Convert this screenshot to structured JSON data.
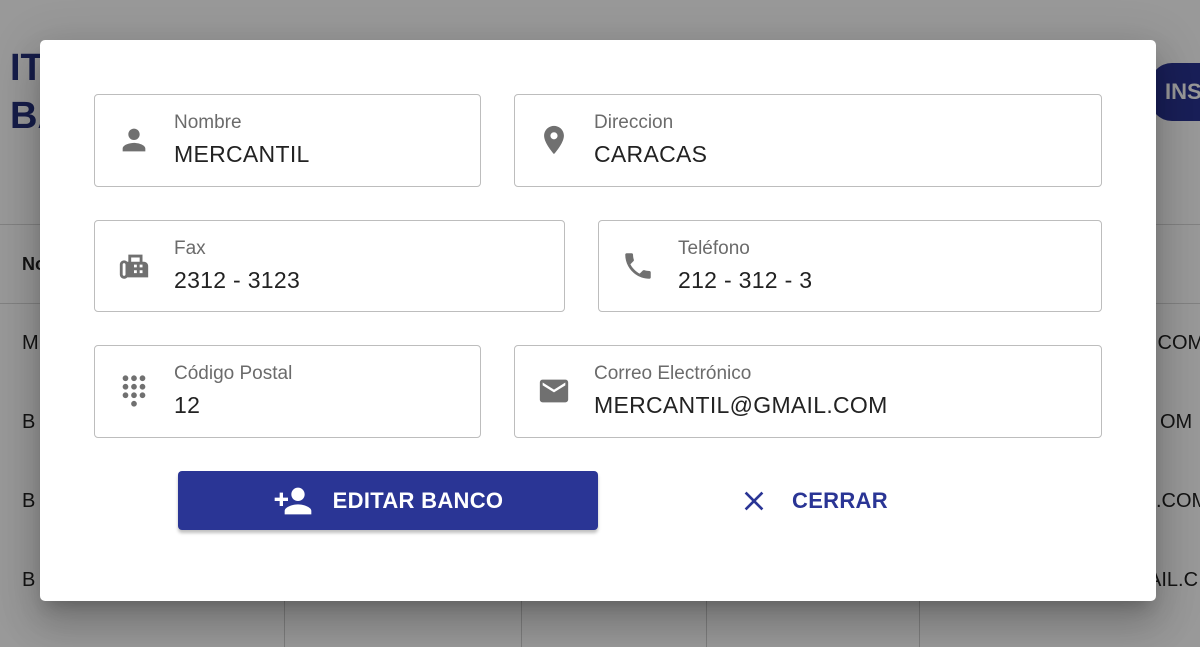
{
  "background": {
    "title_line1": "ITE",
    "title_line2": "BA",
    "insert_button_label": "INS",
    "table_header_first": "No",
    "left_cells": [
      "M",
      "B",
      "B",
      "B"
    ],
    "right_cells": [
      ".COM",
      "OM",
      ".COM",
      "AIL.C"
    ]
  },
  "dialog": {
    "fields": {
      "nombre": {
        "label": "Nombre",
        "value": "MERCANTIL",
        "icon": "person-icon"
      },
      "direccion": {
        "label": "Direccion",
        "value": "CARACAS",
        "icon": "location-pin-icon"
      },
      "fax": {
        "label": "Fax",
        "value": "2312 - 3123",
        "icon": "fax-icon"
      },
      "telefono": {
        "label": "Teléfono",
        "value": "212 - 312 - 3",
        "icon": "phone-icon"
      },
      "codigo_postal": {
        "label": "Código Postal",
        "value": "12",
        "icon": "dialpad-icon"
      },
      "correo": {
        "label": "Correo Electrónico",
        "value": "MERCANTIL@GMAIL.COM",
        "icon": "email-icon"
      }
    },
    "buttons": {
      "edit_label": "EDITAR BANCO",
      "close_label": "CERRAR"
    }
  },
  "colors": {
    "primary": "#2a3595",
    "icon_gray": "#707070",
    "label_gray": "#6b6b6b"
  }
}
